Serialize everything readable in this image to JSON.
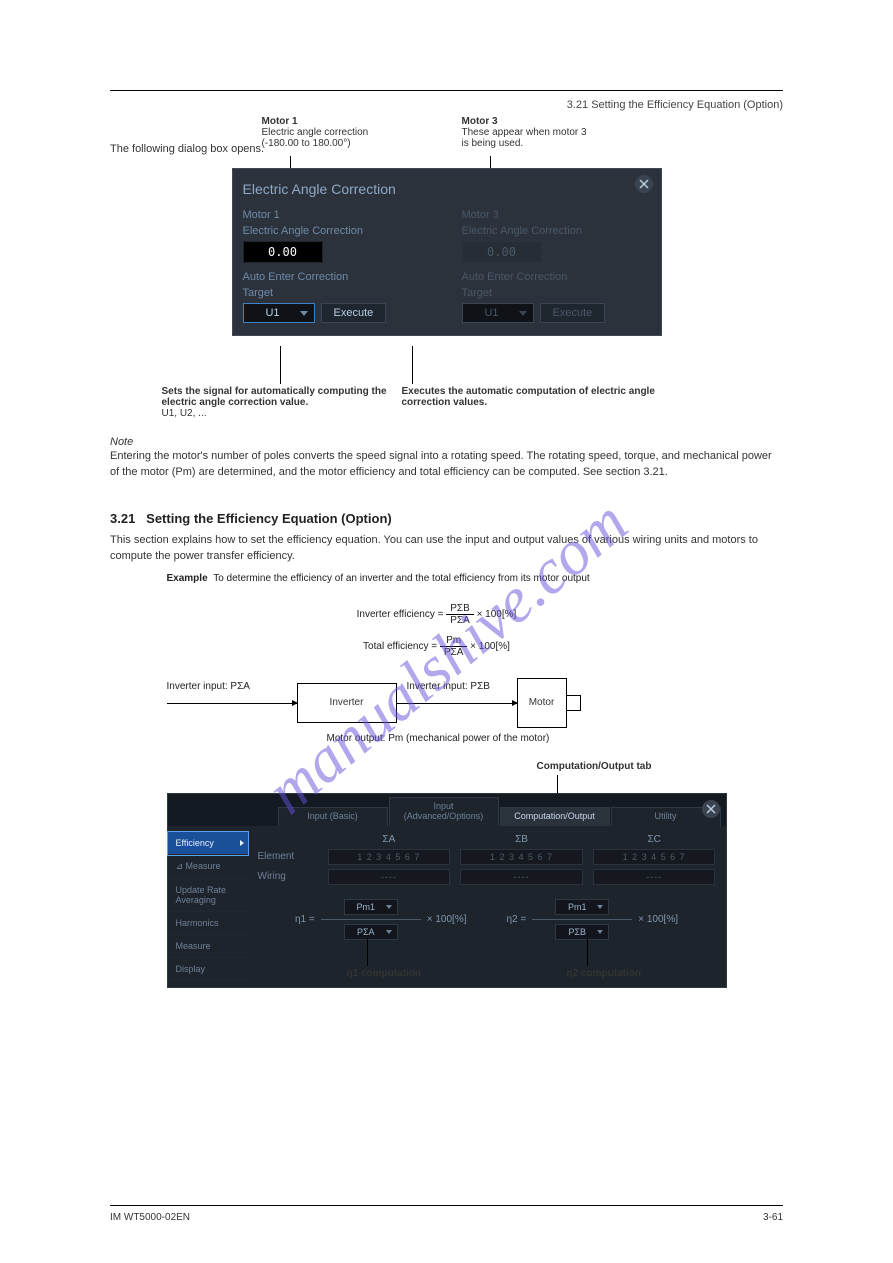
{
  "header": {
    "right": "3.21  Setting the Efficiency Equation (Option)"
  },
  "pre_text": "The following dialog box opens.",
  "callout_above_dialog1": [
    {
      "title": "Motor 1",
      "sub": "Electric angle correction",
      "note": "(-180.00 to 180.00°)"
    },
    {
      "title": "Motor 3",
      "sub": "These appear when motor 3",
      "note": "is being used."
    }
  ],
  "callout_below_dialog1": [
    {
      "title": "Sets the signal for automatically computing the electric angle correction value.",
      "sub": "U1, U2, ..."
    },
    {
      "title": "Executes the automatic computation of electric angle correction values."
    }
  ],
  "dialog1": {
    "title": "Electric Angle Correction",
    "motor1": {
      "name": "Motor 1",
      "label_correction": "Electric Angle Correction",
      "value": "0.00",
      "label_auto1": "Auto Enter Correction",
      "label_auto2": "Target",
      "select": "U1",
      "execute": "Execute"
    },
    "motor3": {
      "name": "Motor 3",
      "label_correction": "Electric Angle Correction",
      "value": "0.00",
      "label_auto1": "Auto Enter Correction",
      "label_auto2": "Target",
      "select": "U1",
      "execute": "Execute"
    }
  },
  "note_block": {
    "heading": "Note",
    "text": "Entering the motor's number of poles converts the speed signal into a rotating speed. The rotating speed, torque, and mechanical power of the motor (Pm) are determined, and the motor efficiency and total efficiency can be computed. See section 3.21."
  },
  "section": {
    "number": "3.21",
    "title": "Setting the Efficiency Equation (Option)"
  },
  "intro_text": "This section explains how to set the efficiency equation. You can use the input and output values of various wiring units and motors to compute the power transfer efficiency.",
  "diagram": {
    "example_lead": "Example",
    "example_text": "To determine the efficiency of an inverter and the total efficiency from its motor output",
    "inverter_input": "Inverter input: PΣA",
    "inverter_output": "Inverter input: PΣB",
    "box_inverter": "Inverter",
    "box_motor": "Motor",
    "motor_output": "Motor output: Pm (mechanical power of the motor)",
    "eq1": "Inverter efficiency =",
    "eq1_frac_top": "PΣB",
    "eq1_frac_bot": "PΣA",
    "eq1_tail": "× 100[%]",
    "eq2": "Total efficiency =",
    "eq2_frac_top": "Pm",
    "eq2_frac_bot": "PΣA",
    "eq2_tail": "× 100[%]"
  },
  "callout_above_dialog2": "Computation/Output tab",
  "dialog2": {
    "tabs": [
      "Input\n(Basic)",
      "Input\n(Advanced/Options)",
      "Computation/Output",
      "Utility"
    ],
    "active_tab": 2,
    "sidebar": [
      "Efficiency",
      "⊿ Measure",
      "Update Rate Averaging",
      "Harmonics",
      "Measure",
      "Display"
    ],
    "active_side": 0,
    "cols": [
      "ΣA",
      "ΣB",
      "ΣC"
    ],
    "row_element_label": "Element",
    "row_element_val": "1 2 3 4 5 6 7",
    "row_wiring_label": "Wiring",
    "row_wiring_val": "----",
    "eq1_lhs": "η1 =",
    "eq1_top": "Pm1",
    "eq1_bot": "PΣA",
    "eq1_tail": "× 100[%]",
    "eq2_lhs": "η2 =",
    "eq2_top": "Pm1",
    "eq2_bot": "PΣB",
    "eq2_tail": "× 100[%]"
  },
  "callout_below_dialog2": [
    "η1 computation",
    "η2 computation"
  ],
  "footer": {
    "left": "IM WT5000-02EN",
    "right": "3-61"
  },
  "watermark": "manualshive.com"
}
